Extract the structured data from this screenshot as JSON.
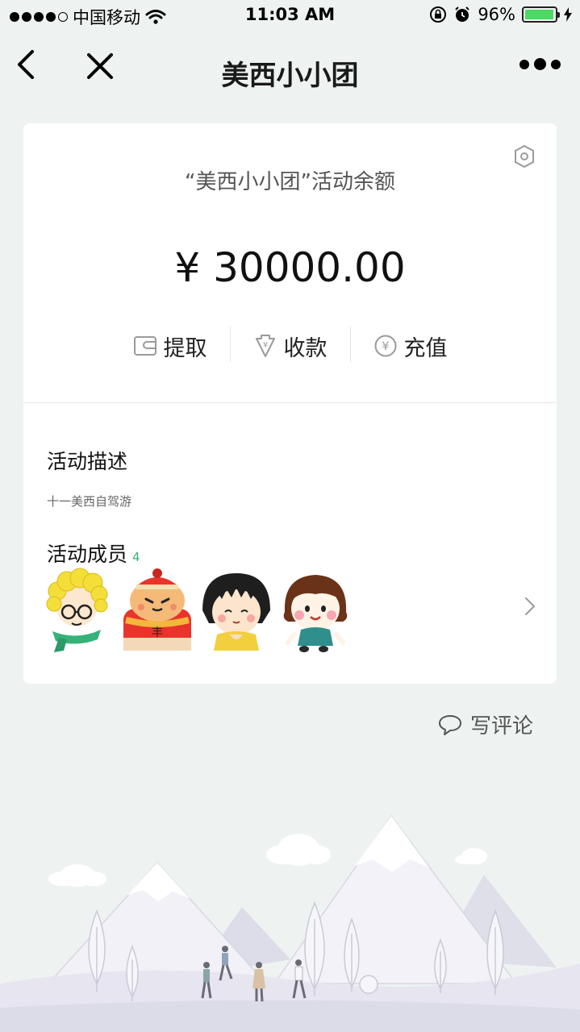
{
  "status_bar": {
    "carrier": "中国移动",
    "time": "11:03 AM",
    "battery": "96%",
    "battery_level": 0.96,
    "icons": [
      "signal-dots-icon",
      "wifi-icon",
      "orientation-lock-icon",
      "alarm-icon",
      "battery-icon",
      "charging-icon"
    ]
  },
  "nav": {
    "title": "美西小小团",
    "icons": [
      "back-arrow-icon",
      "close-icon",
      "more-icon"
    ]
  },
  "balance": {
    "label": "“美西小小团”活动余额",
    "amount": "¥ 30000.00"
  },
  "actions": [
    {
      "label": "提取",
      "icon": "wallet-icon"
    },
    {
      "label": "收款",
      "icon": "receive-icon"
    },
    {
      "label": "充值",
      "icon": "yuan-coin-icon"
    }
  ],
  "description": {
    "title": "活动描述",
    "text": "十一美西自驾游"
  },
  "members": {
    "title": "活动成员",
    "count": "4"
  },
  "comment": {
    "label": "写评论",
    "icon": "comment-bubble-icon"
  },
  "colors": {
    "background": "#eef3f2",
    "card": "#ffffff",
    "accent_green": "#39b27b",
    "battery_green": "#4cd964"
  }
}
